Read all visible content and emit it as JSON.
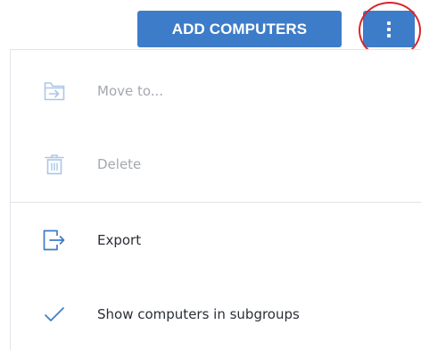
{
  "toolbar": {
    "add_computers_label": "ADD COMPUTERS",
    "more_icon": "vertical-ellipsis-icon"
  },
  "menu": {
    "items": [
      {
        "label": "Move to...",
        "icon": "move-to-folder-icon",
        "enabled": false
      },
      {
        "label": "Delete",
        "icon": "trash-icon",
        "enabled": false
      },
      {
        "label": "Export",
        "icon": "export-icon",
        "enabled": true
      },
      {
        "label": "Show computers in subgroups",
        "icon": "checkmark-icon",
        "enabled": true,
        "checked": true
      }
    ]
  },
  "colors": {
    "primary": "#3d7cc9",
    "highlight_ring": "#d9262c",
    "disabled_icon": "#a9c7ea",
    "enabled_icon": "#3d7cc9",
    "disabled_text": "#a4a8ae",
    "enabled_text": "#2b2f36"
  }
}
